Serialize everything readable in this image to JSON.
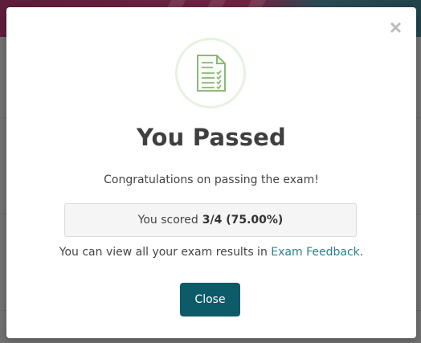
{
  "modal": {
    "close_symbol": "×",
    "icon": "checklist-document-icon",
    "title": "You Passed",
    "message": "Congratulations on passing the exam!",
    "score_prefix": "You scored",
    "score_value": "3/4 (75.00%)",
    "results_text": "You can view all your exam results in",
    "results_link": "Exam Feedback",
    "results_suffix": ".",
    "close_button": "Close"
  },
  "colors": {
    "primary_button": "#0d5a69",
    "link": "#2a7f8d",
    "icon_green": "#8cb878",
    "icon_ring": "#e7f2e0"
  }
}
